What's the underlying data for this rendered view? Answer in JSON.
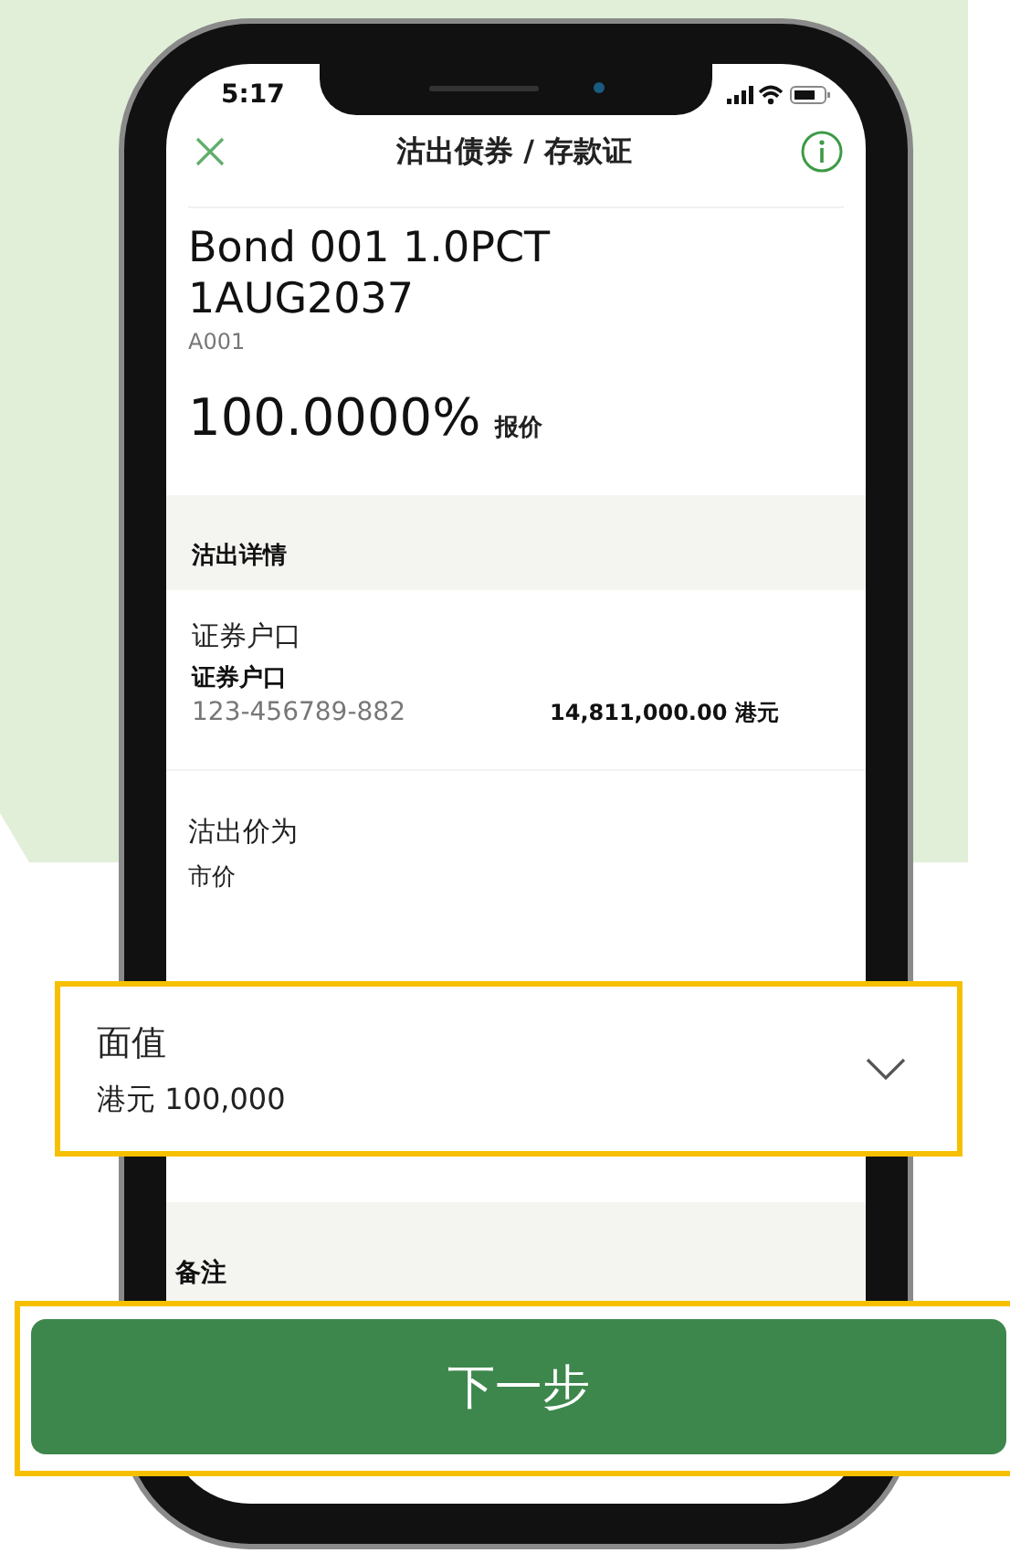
{
  "status_bar": {
    "time": "5:17"
  },
  "header": {
    "title": "沽出债券 / 存款证"
  },
  "bond": {
    "name": "Bond 001 1.0PCT 1AUG2037",
    "code": "A001",
    "price": "100.0000%",
    "price_label": "报价"
  },
  "details": {
    "title": "沽出详情",
    "account": {
      "label": "证券户口",
      "name": "证券户口",
      "number": "123-456789-882",
      "balance": "14,811,000.00 港元"
    },
    "sell_price": {
      "label": "沽出价为",
      "value": "市价"
    }
  },
  "face_value": {
    "label": "面值",
    "value": "港元 100,000"
  },
  "remarks": {
    "title": "备注"
  },
  "next_button": {
    "label": "下一步"
  }
}
